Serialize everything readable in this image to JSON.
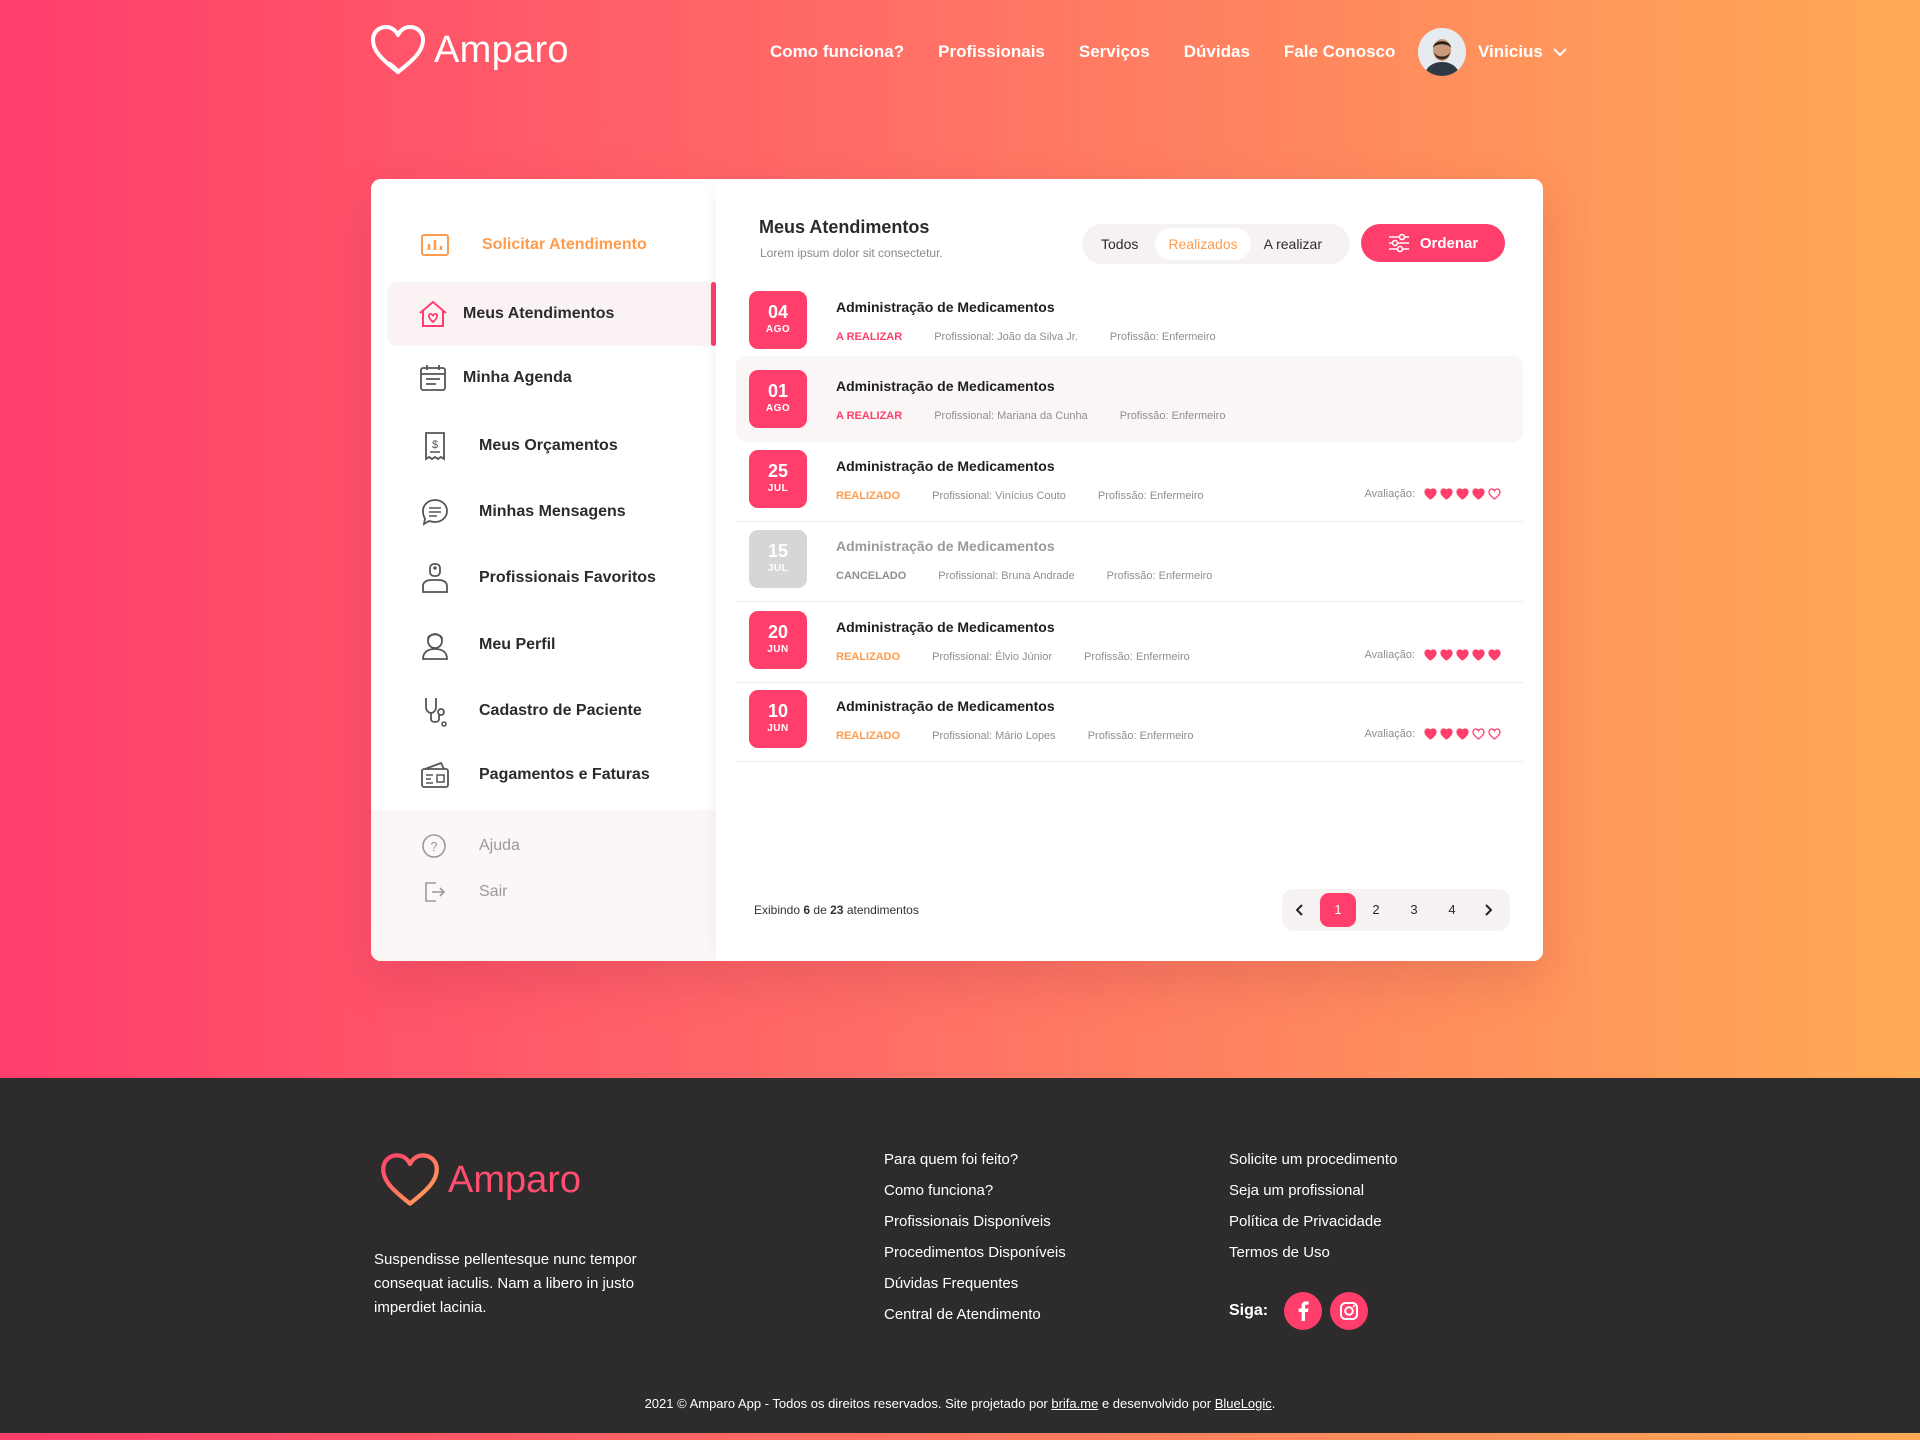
{
  "brand": {
    "name": "Amparo",
    "primary": "#ff3e6c",
    "accent": "#ff9b4a"
  },
  "nav": [
    "Como funciona?",
    "Profissionais",
    "Serviços",
    "Dúvidas",
    "Fale Conosco"
  ],
  "user": {
    "name": "Vinicius"
  },
  "sidebar": {
    "items": [
      {
        "label": "Solicitar Atendimento",
        "icon": "chart-icon"
      },
      {
        "label": "Meus Atendimentos",
        "icon": "house-heart-icon"
      },
      {
        "label": "Minha Agenda",
        "icon": "calendar-icon"
      },
      {
        "label": "Meus Orçamentos",
        "icon": "receipt-dollar-icon"
      },
      {
        "label": "Minhas Mensagens",
        "icon": "chat-icon"
      },
      {
        "label": "Profissionais Favoritos",
        "icon": "doctor-icon"
      },
      {
        "label": "Meu Perfil",
        "icon": "profile-icon"
      },
      {
        "label": "Cadastro de Paciente",
        "icon": "stethoscope-icon"
      },
      {
        "label": "Pagamentos e Faturas",
        "icon": "wallet-icon"
      }
    ],
    "help": "Ajuda",
    "logout": "Sair"
  },
  "main": {
    "title": "Meus Atendimentos",
    "subtitle": "Lorem ipsum dolor sit consectetur.",
    "filters": [
      "Todos",
      "Realizados",
      "A realizar"
    ],
    "selected_filter": "Realizados",
    "order_label": "Ordenar",
    "rating_label": "Avaliação:",
    "appointments": [
      {
        "day": "04",
        "month": "AGO",
        "title": "Administração de Medicamentos",
        "status": "A REALIZAR",
        "professional": "Profissional: João da Silva Jr.",
        "profession": "Profissão: Enfermeiro",
        "rating": null
      },
      {
        "day": "01",
        "month": "AGO",
        "title": "Administração de Medicamentos",
        "status": "A REALIZAR",
        "professional": "Profissional: Mariana da Cunha",
        "profession": "Profissão: Enfermeiro",
        "rating": null
      },
      {
        "day": "25",
        "month": "JUL",
        "title": "Administração de Medicamentos",
        "status": "REALIZADO",
        "professional": "Profissional: Vinícius Couto",
        "profession": "Profissão: Enfermeiro",
        "rating": 4
      },
      {
        "day": "15",
        "month": "JUL",
        "title": "Administração de Medicamentos",
        "status": "CANCELADO",
        "professional": "Profissional: Bruna Andrade",
        "profession": "Profissão: Enfermeiro",
        "rating": null
      },
      {
        "day": "20",
        "month": "JUN",
        "title": "Administração de Medicamentos",
        "status": "REALIZADO",
        "professional": "Profissional: Élvio Júnior",
        "profession": "Profissão: Enfermeiro",
        "rating": 5
      },
      {
        "day": "10",
        "month": "JUN",
        "title": "Administração de Medicamentos",
        "status": "REALIZADO",
        "professional": "Profissional: Mário Lopes",
        "profession": "Profissão: Enfermeiro",
        "rating": 3
      }
    ],
    "showing": {
      "prefix": "Exibindo",
      "count": "6",
      "of": "de",
      "total": "23",
      "suffix": "atendimentos"
    },
    "pages": [
      "1",
      "2",
      "3",
      "4"
    ],
    "current_page": "1"
  },
  "footer": {
    "description": "Suspendisse pellentesque nunc tempor consequat iaculis. Nam a libero in justo imperdiet lacinia.",
    "col1": [
      "Para quem foi feito?",
      "Como funciona?",
      "Profissionais Disponíveis",
      "Procedimentos Disponíveis",
      "Dúvidas Frequentes",
      "Central de Atendimento"
    ],
    "col2": [
      "Solicite um procedimento",
      "Seja um profissional",
      "Política de Privacidade",
      "Termos de Uso"
    ],
    "follow": "Siga:",
    "copyright_pre": "2021 © Amparo App - Todos os direitos reservados. Site projetado por ",
    "copyright_link1": "brifa.me",
    "copyright_mid": " e desenvolvido por ",
    "copyright_link2": "BlueLogic",
    "copyright_end": "."
  }
}
